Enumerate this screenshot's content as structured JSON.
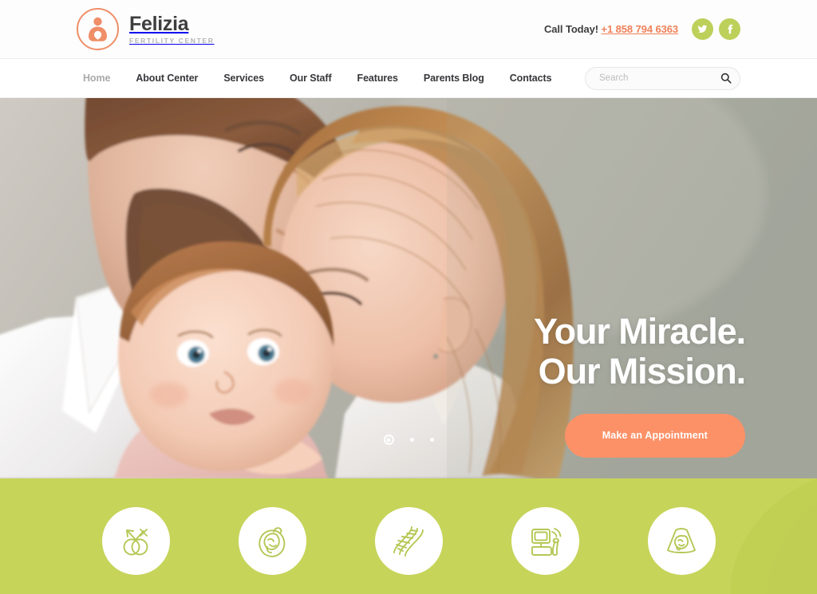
{
  "brand": {
    "name": "Felizia",
    "tagline": "FERTILITY CENTER",
    "icon": "mother-and-baby-icon",
    "accent_color": "#ef8e68"
  },
  "topbar": {
    "call_label": "Call Today!",
    "phone": "+1 858 794 6363",
    "socials": [
      {
        "name": "twitter-icon",
        "label": "Twitter"
      },
      {
        "name": "facebook-icon",
        "label": "Facebook"
      }
    ],
    "social_color": "#bcd05a",
    "phone_color": "#ef8158"
  },
  "nav": {
    "items": [
      {
        "label": "Home",
        "active": true
      },
      {
        "label": "About Center",
        "active": false
      },
      {
        "label": "Services",
        "active": false
      },
      {
        "label": "Our Staff",
        "active": false
      },
      {
        "label": "Features",
        "active": false
      },
      {
        "label": "Parents Blog",
        "active": false
      },
      {
        "label": "Contacts",
        "active": false
      }
    ]
  },
  "search": {
    "placeholder": "Search",
    "value": "",
    "icon": "search-icon"
  },
  "hero": {
    "title_line1": "Your Miracle.",
    "title_line2": "Our Mission.",
    "cta_label": "Make an Appointment",
    "cta_color": "#fc9167",
    "photo_alt": "Parents kissing their newborn baby",
    "slides": [
      {
        "index": 1,
        "active": true
      },
      {
        "index": 2,
        "active": false
      },
      {
        "index": 3,
        "active": false
      }
    ]
  },
  "services": {
    "band_color": "#c6d45a",
    "items": [
      {
        "icon": "gender-symbols-icon",
        "label": "Gender Symbols"
      },
      {
        "icon": "fetus-icon",
        "label": "Fetus"
      },
      {
        "icon": "dna-helix-icon",
        "label": "DNA Helix"
      },
      {
        "icon": "ultrasound-machine-icon",
        "label": "Ultrasound Machine"
      },
      {
        "icon": "ultrasound-scan-icon",
        "label": "Ultrasound Scan"
      }
    ]
  }
}
